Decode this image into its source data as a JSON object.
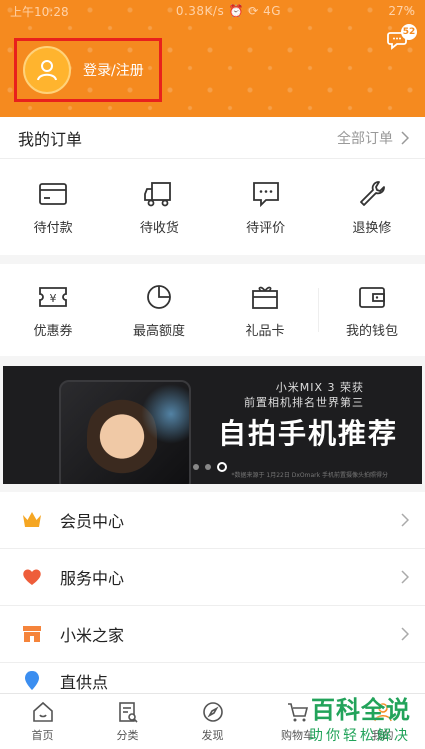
{
  "status_bar": {
    "time": "上午10:28",
    "network": "0.38K/s ⏰ ⟳ 4G",
    "battery": "27%"
  },
  "header": {
    "login_label": "登录/注册",
    "message_badge": "52",
    "bg_color": "#f58a1f"
  },
  "orders": {
    "title": "我的订单",
    "all_label": "全部订单",
    "items": [
      {
        "label": "待付款",
        "icon": "card-icon"
      },
      {
        "label": "待收货",
        "icon": "truck-icon"
      },
      {
        "label": "待评价",
        "icon": "comment-icon"
      },
      {
        "label": "退换修",
        "icon": "wrench-icon"
      }
    ]
  },
  "assets": {
    "items": [
      {
        "label": "优惠券",
        "icon": "coupon-icon"
      },
      {
        "label": "最高额度",
        "icon": "pie-chart-icon"
      },
      {
        "label": "礼品卡",
        "icon": "gift-card-icon"
      },
      {
        "label": "我的钱包",
        "icon": "wallet-icon"
      }
    ]
  },
  "banner": {
    "line1": "小米MIX 3 荣获",
    "line2": "前置相机排名世界第三",
    "headline": "自拍手机推荐",
    "fine_print": "*数据来源于 1月22日 DxOmark 手机前置摄像头拍照得分"
  },
  "menu": {
    "items": [
      {
        "label": "会员中心",
        "icon": "crown-icon",
        "color": "#f5a623"
      },
      {
        "label": "服务中心",
        "icon": "heart-hand-icon",
        "color": "#ee5d3a"
      },
      {
        "label": "小米之家",
        "icon": "store-icon",
        "color": "#f5843b"
      },
      {
        "label": "直供点",
        "icon": "location-icon",
        "color": "#3b8ef0"
      }
    ]
  },
  "bottom_nav": {
    "items": [
      {
        "label": "首页",
        "icon": "home-icon"
      },
      {
        "label": "分类",
        "icon": "category-icon"
      },
      {
        "label": "发现",
        "icon": "compass-icon"
      },
      {
        "label": "购物车",
        "icon": "cart-icon"
      },
      {
        "label": "我的",
        "icon": "user-icon"
      }
    ]
  },
  "watermark": {
    "line1": "百科全说",
    "line2": "助你轻松解决"
  }
}
